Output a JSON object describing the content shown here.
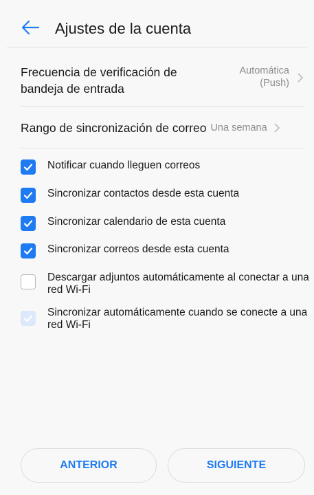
{
  "header": {
    "title": "Ajustes de la cuenta",
    "back_icon": "arrow-left-icon"
  },
  "settings": {
    "inbox_frequency": {
      "label": "Frecuencia de verificación de bandeja de entrada",
      "value": "Automática (Push)"
    },
    "sync_range": {
      "label": "Rango de sincronización de correo",
      "value": "Una semana"
    }
  },
  "options": [
    {
      "label": "Notificar cuando lleguen correos",
      "checked": true,
      "disabled": false
    },
    {
      "label": "Sincronizar contactos desde esta cuenta",
      "checked": true,
      "disabled": false
    },
    {
      "label": "Sincronizar calendario de esta cuenta",
      "checked": true,
      "disabled": false
    },
    {
      "label": "Sincronizar correos desde esta cuenta",
      "checked": true,
      "disabled": false
    },
    {
      "label": "Descargar adjuntos automáticamente al conectar a una red Wi-Fi",
      "checked": false,
      "disabled": false
    },
    {
      "label": "Sincronizar automáticamente cuando se conecte a una red Wi-Fi",
      "checked": true,
      "disabled": true
    }
  ],
  "buttons": {
    "previous": "ANTERIOR",
    "next": "SIGUIENTE"
  },
  "colors": {
    "accent": "#1e7bf2",
    "disabled_check": "#dce9fb",
    "secondary_text": "#8c8c8c"
  }
}
